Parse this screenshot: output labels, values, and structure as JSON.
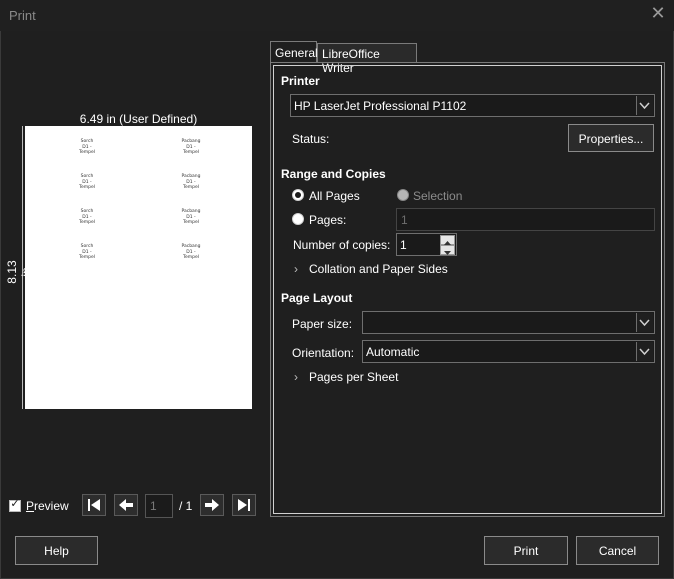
{
  "window": {
    "title": "Print",
    "close_icon": "close-icon"
  },
  "preview": {
    "width_label": "6.49 in (User Defined)",
    "height_label": "8.13 in",
    "label_cells": [
      {
        "text": "Sorch\nD1 -\nTempel"
      },
      {
        "text": "Pacbang\nD1 -\nTempel"
      },
      {
        "text": "Sorch\nD1 -\nTempel"
      },
      {
        "text": "Pacbang\nD1 -\nTempel"
      },
      {
        "text": "Sorch\nD1 -\nTempel"
      },
      {
        "text": "Pacbang\nD1 -\nTempel"
      },
      {
        "text": "Sorch\nD1 -\nTempel"
      },
      {
        "text": "Pacbang\nD1 -\nTempel"
      }
    ],
    "preview_checkbox_label": "Preview",
    "preview_checked": true,
    "current_page": "1",
    "page_total": "/ 1"
  },
  "tabs": [
    {
      "label": "General",
      "active": true
    },
    {
      "label": "LibreOffice Writer",
      "active": false
    }
  ],
  "printer": {
    "section_title": "Printer",
    "selected_printer": "HP LaserJet Professional P1102",
    "status_label": "Status:",
    "properties_button": "Properties..."
  },
  "range": {
    "section_title": "Range and Copies",
    "all_pages_label": "All Pages",
    "selection_label": "Selection",
    "pages_label": "Pages:",
    "pages_value": "1",
    "copies_label": "Number of copies:",
    "copies_value": "1",
    "collation_label": "Collation and Paper Sides"
  },
  "layout": {
    "section_title": "Page Layout",
    "paper_size_label": "Paper size:",
    "paper_size_value": "",
    "orientation_label": "Orientation:",
    "orientation_value": "Automatic",
    "pages_per_sheet_label": "Pages per Sheet"
  },
  "buttons": {
    "help": "Help",
    "print": "Print",
    "cancel": "Cancel"
  }
}
